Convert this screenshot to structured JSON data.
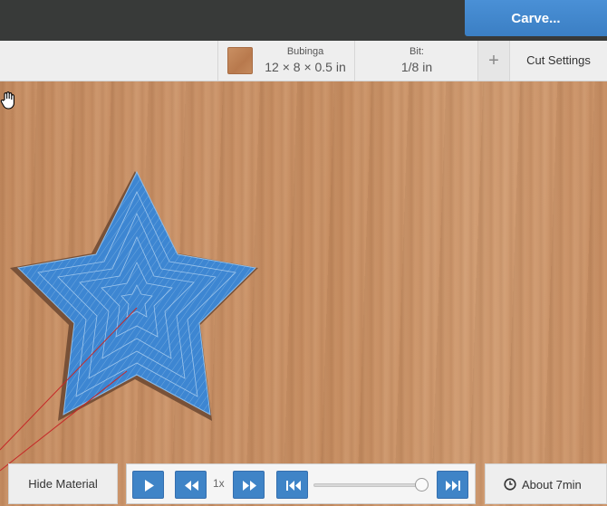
{
  "header": {
    "carve_label": "Carve..."
  },
  "toolbar": {
    "material_name": "Bubinga",
    "material_dims": "12 × 8 × 0.5 in",
    "bit_label": "Bit:",
    "bit_value": "1/8 in",
    "add_icon": "plus-icon",
    "cut_settings_label": "Cut Settings"
  },
  "canvas": {
    "cursor_icon": "hand-cursor-icon",
    "shape": "star"
  },
  "player": {
    "play_icon": "play-icon",
    "rewind_icon": "rewind-icon",
    "speed_label": "1x",
    "fast_forward_icon": "fast-forward-icon",
    "skip_start_icon": "skip-to-start-icon",
    "skip_end_icon": "skip-to-end-icon",
    "progress": 0.97
  },
  "footer": {
    "hide_material_label": "Hide Material",
    "time_label": "About 7min",
    "clock_icon": "clock-icon"
  },
  "colors": {
    "accent": "#3f84c7",
    "toolpath": "#3d86d2",
    "wood": "#c68d61"
  }
}
